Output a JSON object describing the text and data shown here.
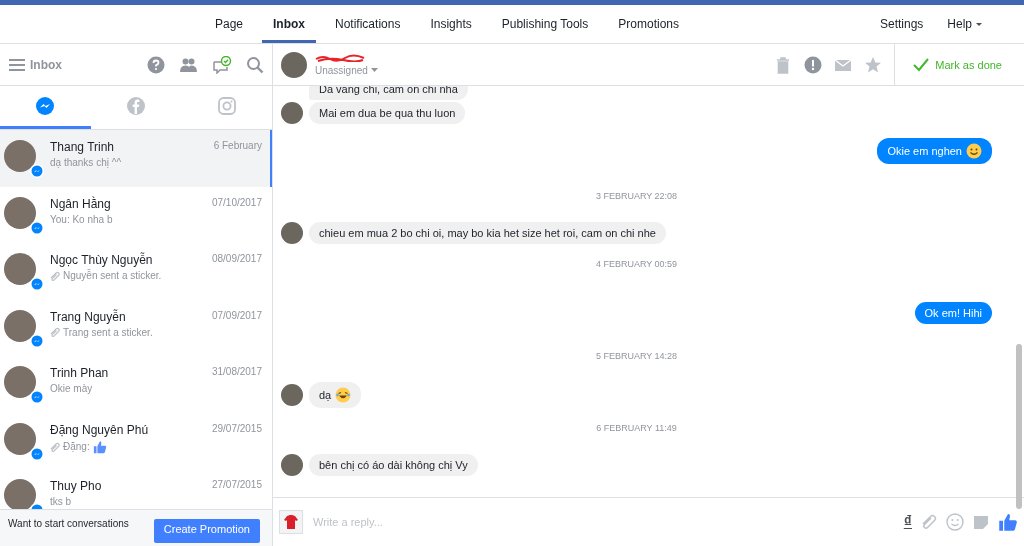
{
  "nav": {
    "tabs": [
      {
        "label": "Page",
        "selected": false
      },
      {
        "label": "Inbox",
        "selected": true
      },
      {
        "label": "Notifications",
        "selected": false
      },
      {
        "label": "Insights",
        "selected": false
      },
      {
        "label": "Publishing Tools",
        "selected": false
      },
      {
        "label": "Promotions",
        "selected": false
      }
    ],
    "right": [
      "Settings",
      "Help"
    ]
  },
  "sidebar": {
    "title": "Inbox",
    "channel_tabs": [
      {
        "kind": "messenger",
        "selected": true
      },
      {
        "kind": "facebook",
        "selected": false
      },
      {
        "kind": "instagram",
        "selected": false
      }
    ],
    "conversations": [
      {
        "name": "Thang Trinh",
        "date": "6 February",
        "preview": "dạ thanks chị ^^",
        "attachment": false,
        "like": false,
        "selected": true
      },
      {
        "name": "Ngân Hằng",
        "date": "07/10/2017",
        "preview": "You: Ko nha b",
        "attachment": false,
        "like": false,
        "selected": false
      },
      {
        "name": "Ngọc Thùy Nguyễn",
        "date": "08/09/2017",
        "preview": "Nguyễn sent a sticker.",
        "attachment": true,
        "like": false,
        "selected": false
      },
      {
        "name": "Trang Nguyễn",
        "date": "07/09/2017",
        "preview": "Trang sent a sticker.",
        "attachment": true,
        "like": false,
        "selected": false
      },
      {
        "name": "Trinh Phan",
        "date": "31/08/2017",
        "preview": "Okie mày",
        "attachment": false,
        "like": false,
        "selected": false
      },
      {
        "name": "Đặng Nguyên Phú",
        "date": "29/07/2015",
        "preview": "Đặng:",
        "attachment": true,
        "like": true,
        "selected": false
      },
      {
        "name": "Thuy Pho",
        "date": "27/07/2015",
        "preview": "tks b",
        "attachment": false,
        "like": false,
        "selected": false
      }
    ],
    "footer": {
      "text": "Want to start conversations",
      "button": "Create Promotion"
    }
  },
  "conversation": {
    "status": "Unassigned",
    "mark_done": "Mark as done",
    "messages": [
      {
        "kind": "them",
        "text": "Da vang chi, cam on chi nha",
        "avatar": false,
        "emoji": false
      },
      {
        "kind": "them",
        "text": "Mai em dua be qua thu luon",
        "avatar": true,
        "emoji": false
      },
      {
        "kind": "me",
        "text": "Okie em nghen",
        "emoji": true
      },
      {
        "kind": "separator",
        "text": "3 FEBRUARY 22:08"
      },
      {
        "kind": "them",
        "text": "chieu em mua 2 bo chi oi, may bo kia het size het roi, cam on chi nhe",
        "avatar": true,
        "emoji": false
      },
      {
        "kind": "separator",
        "text": "4 FEBRUARY 00:59"
      },
      {
        "kind": "me",
        "text": "Ok em! Hihi",
        "emoji": false
      },
      {
        "kind": "separator",
        "text": "5 FEBRUARY 14:28"
      },
      {
        "kind": "them",
        "text": "dạ",
        "avatar": true,
        "emoji": true
      },
      {
        "kind": "separator",
        "text": "6 FEBRUARY 11:49"
      },
      {
        "kind": "them",
        "text": "bên chị có áo dài không chị Vy",
        "avatar": true,
        "emoji": false
      }
    ],
    "composer": {
      "placeholder": "Write a reply...",
      "currency_button": "₫"
    }
  }
}
